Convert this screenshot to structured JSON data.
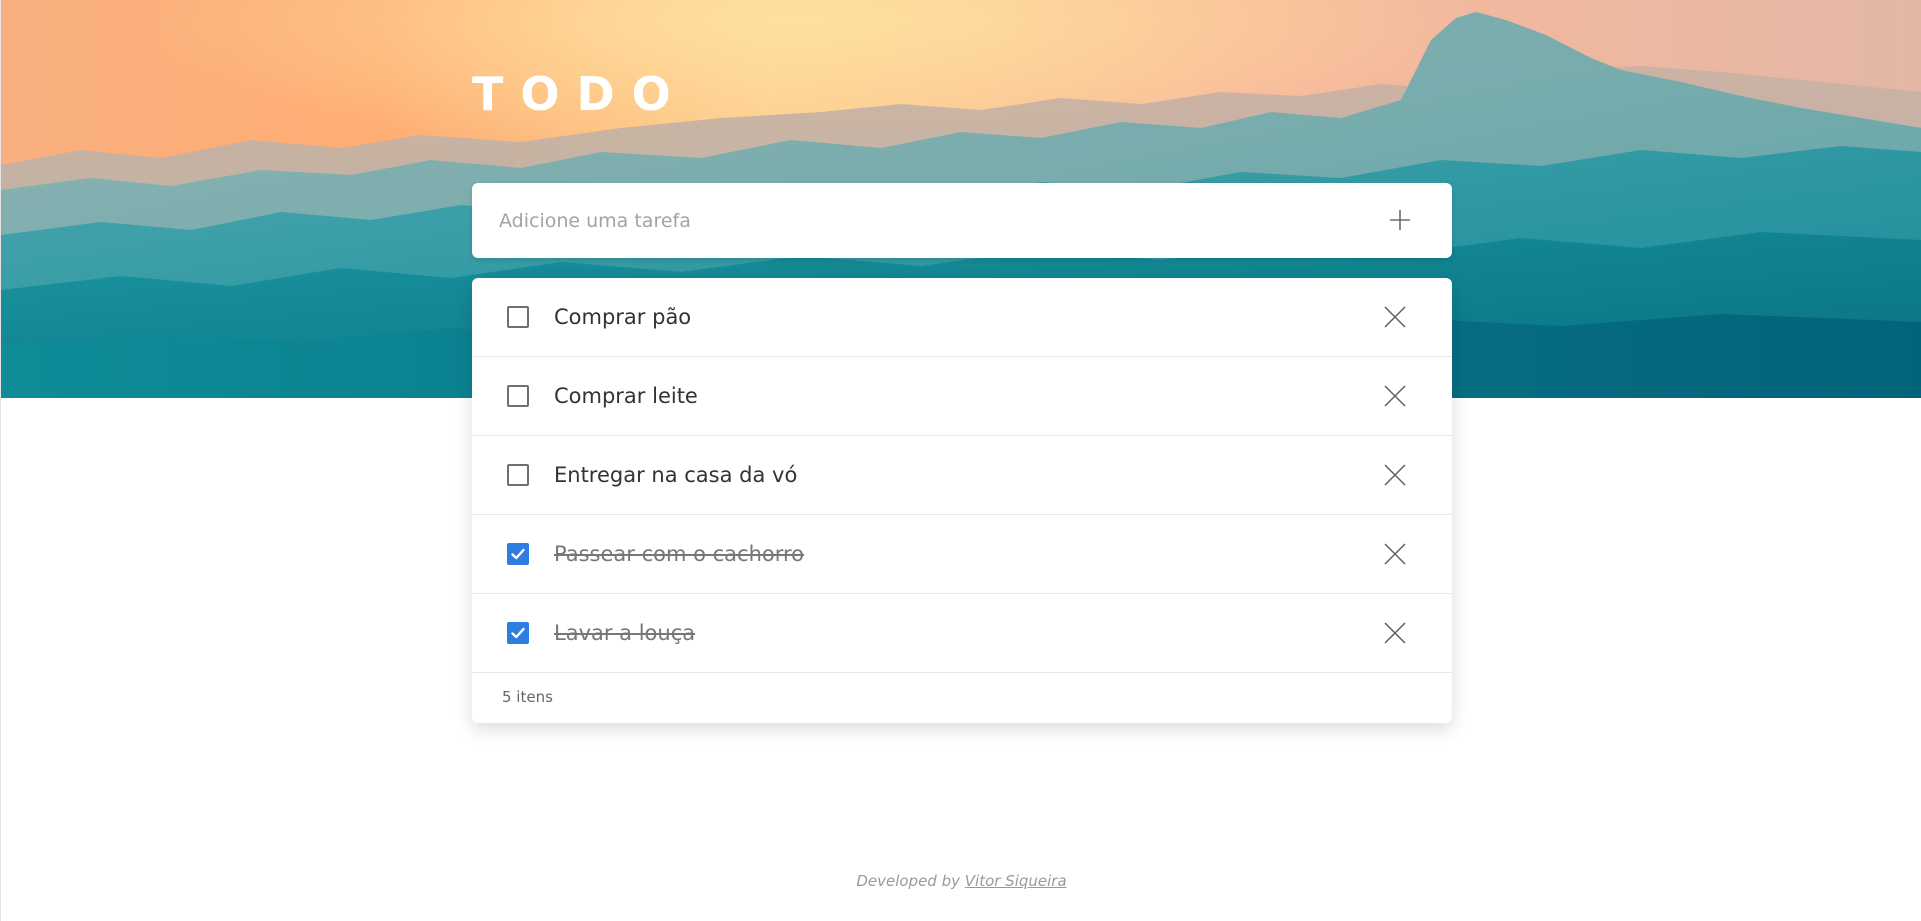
{
  "header": {
    "title": "TODO"
  },
  "new_task": {
    "placeholder": "Adicione uma tarefa",
    "value": "",
    "add_icon": "plus-icon"
  },
  "todos": {
    "items": [
      {
        "label": "Comprar pão",
        "completed": false
      },
      {
        "label": "Comprar leite",
        "completed": false
      },
      {
        "label": "Entregar na casa da vó",
        "completed": false
      },
      {
        "label": "Passear com o cachorro",
        "completed": true
      },
      {
        "label": "Lavar a louça",
        "completed": true
      }
    ],
    "delete_icon": "close-icon",
    "count_label": "5 itens"
  },
  "footer": {
    "developed_by": "Developed by ",
    "author": "Vitor Siqueira"
  },
  "colors": {
    "accent": "#2f7de1",
    "sky_warm": "#ffb27a",
    "sky_light": "#fdd08c",
    "mountain_teal": "#0e8f99",
    "mountain_dark": "#066a7d"
  }
}
